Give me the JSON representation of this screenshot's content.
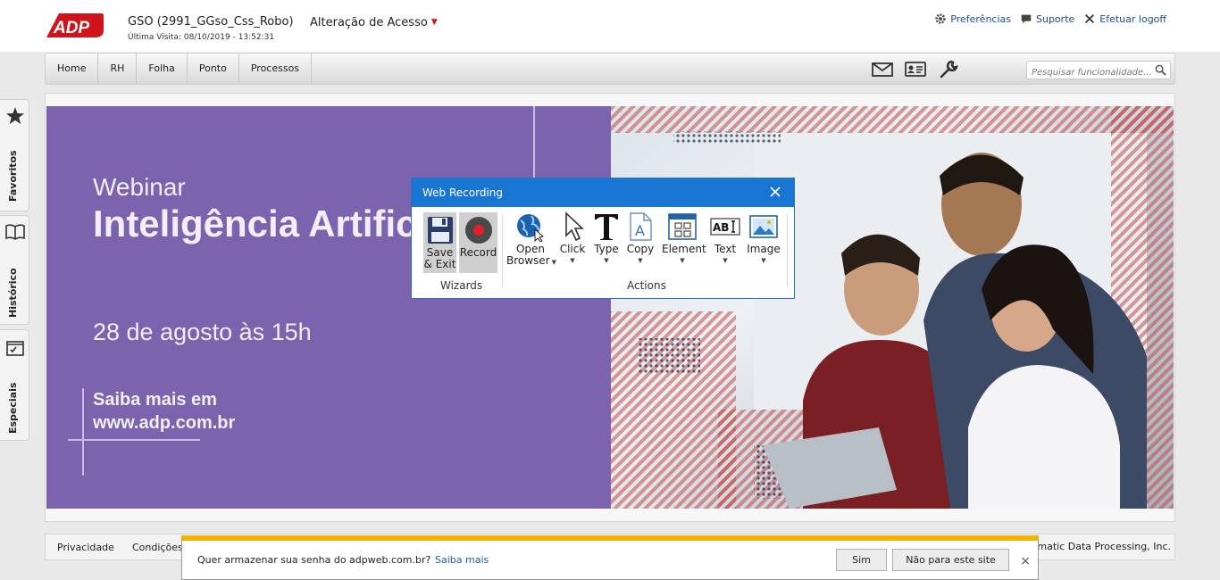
{
  "header": {
    "logo_text": "ADP",
    "company": "GSO (2991_GGso_Css_Robo)",
    "last_visit": "Última Visita: 08/10/2019 - 13:52:31",
    "access_change": "Alteração de Acesso",
    "links": {
      "preferences": "Preferências",
      "support": "Suporte",
      "logoff": "Efetuar logoff"
    }
  },
  "nav": {
    "items": [
      "Home",
      "RH",
      "Folha",
      "Ponto",
      "Processos"
    ],
    "search_placeholder": "Pesquisar funcionalidade..."
  },
  "sidebar": {
    "favorites": "Favoritos",
    "history": "Histórico",
    "special": "Especiais"
  },
  "banner": {
    "kicker": "Webinar",
    "title": "Inteligência Artificial",
    "date": "28 de agosto às 15h",
    "more_line1": "Saiba mais em",
    "more_line2": "www.adp.com.br"
  },
  "dialog": {
    "title": "Web Recording",
    "tools": {
      "save_exit": [
        "Save",
        "& Exit"
      ],
      "record": "Record",
      "open_browser": [
        "Open",
        "Browser"
      ],
      "click": "Click",
      "type": "Type",
      "copy": "Copy",
      "element": "Element",
      "text": "Text",
      "image": "Image"
    },
    "groups": {
      "wizards": "Wizards",
      "actions": "Actions"
    }
  },
  "footer": {
    "privacy": "Privacidade",
    "conditions": "Condições",
    "copyright": "omatic Data Processing, Inc."
  },
  "password_bar": {
    "message": "Quer armazenar sua senha do adpweb.com.br?",
    "learn_more": "Saiba mais",
    "yes": "Sim",
    "no": "Não para este site",
    "close": "×"
  },
  "colors": {
    "adp_red": "#d0121b",
    "banner_purple": "#7b63ae",
    "dialog_blue": "#1876d2",
    "bar_yellow": "#f4b400"
  }
}
